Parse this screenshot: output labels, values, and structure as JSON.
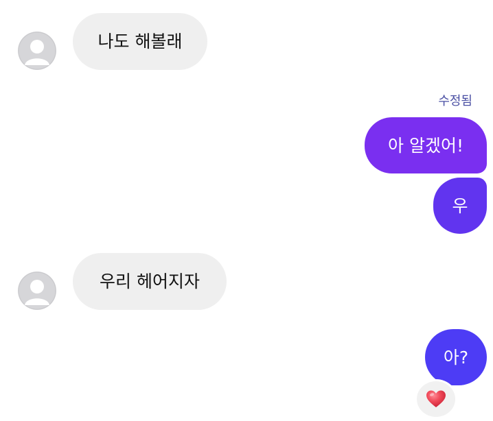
{
  "messages": [
    {
      "id": "m1",
      "side": "incoming",
      "text": "나도 해볼래"
    },
    {
      "id": "m2",
      "side": "outgoing",
      "text": "아 알겠어!",
      "meta": "수정됨"
    },
    {
      "id": "m3",
      "side": "outgoing",
      "text": "우"
    },
    {
      "id": "m4",
      "side": "incoming",
      "text": "우리 헤어지자"
    },
    {
      "id": "m5",
      "side": "outgoing",
      "text": "아?",
      "reaction": "heart"
    }
  ],
  "colors": {
    "outgoing_top": "#7a2ff0",
    "outgoing_mid": "#6134ef",
    "outgoing_bottom": "#4d3cf5",
    "incoming_bg": "#efefef",
    "edited_label": "#4a4fa3",
    "heart": "#e53a4a"
  },
  "icons": {
    "avatar": "default-user-silhouette-icon",
    "reaction": "heart-icon"
  }
}
